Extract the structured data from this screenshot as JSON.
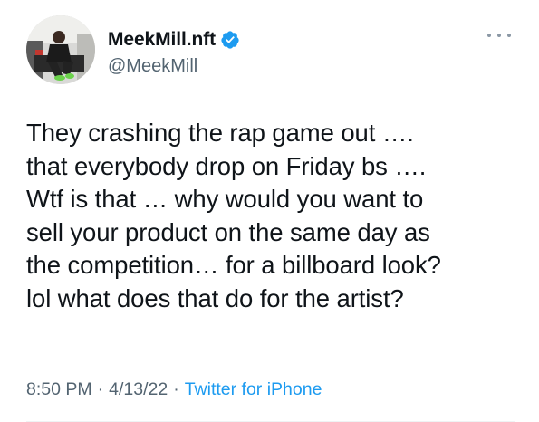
{
  "user": {
    "display_name": "MeekMill.nft",
    "handle": "@MeekMill",
    "verified": true,
    "verified_color": "#1d9bf0"
  },
  "tweet": {
    "lines": [
      "They crashing the rap game out ….",
      "that everybody drop on Friday bs ….",
      "Wtf is that … why would you want to",
      "sell your product on the same day as",
      "the competition… for a billboard look?",
      "lol what does that do for the artist?"
    ],
    "time": "8:50 PM",
    "date": "4/13/22",
    "separator": "·",
    "source": "Twitter for iPhone"
  },
  "colors": {
    "text": "#0f1419",
    "secondary": "#536471",
    "link": "#1d9bf0"
  },
  "icons": {
    "more": "more-horizontal-icon",
    "verified": "verified-badge-icon"
  }
}
